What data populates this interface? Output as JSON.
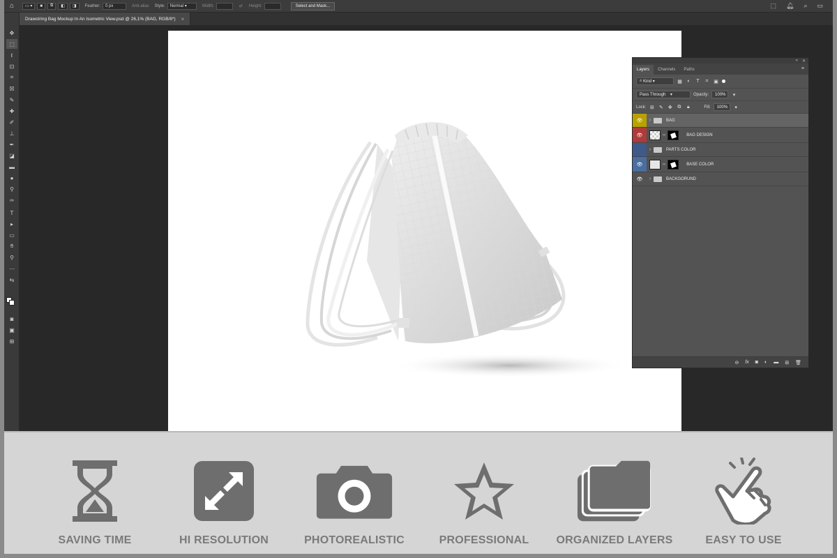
{
  "options_bar": {
    "feather_label": "Feather:",
    "feather_value": "0 px",
    "anti_alias_label": "Anti-alias",
    "style_label": "Style:",
    "style_value": "Normal",
    "width_label": "Width:",
    "height_label": "Height:",
    "select_mask_label": "Select and Mask..."
  },
  "document": {
    "tab_title": "Drawstring Bag Mockup In An Isometric View.psd @ 26,1% (BAG, RGB/8*)",
    "close_glyph": "×"
  },
  "layers_panel": {
    "tabs": [
      "Layers",
      "Channels",
      "Paths"
    ],
    "filter_label": "Kind",
    "blend_mode": "Pass Through",
    "opacity_label": "Opacity:",
    "opacity_value": "100%",
    "lock_label": "Lock:",
    "fill_label": "Fill:",
    "fill_value": "100%",
    "layers": [
      {
        "name": "BAG",
        "type": "group",
        "tag_color": "#b8a200",
        "selected": true
      },
      {
        "name": "BAG DESIGN",
        "type": "smart",
        "tag_color": "#b03a3a",
        "selected": false
      },
      {
        "name": "PARTS COLOR",
        "type": "group",
        "tag_color": "#3e5a8a",
        "selected": false
      },
      {
        "name": "BASE COLOR",
        "type": "fill",
        "tag_color": "#4a6ea0",
        "selected": false
      },
      {
        "name": "BACKGORUND",
        "type": "group",
        "tag_color": "",
        "selected": false
      }
    ]
  },
  "features": [
    {
      "label": "SAVING TIME",
      "icon": "hourglass-icon"
    },
    {
      "label": "HI RESOLUTION",
      "icon": "expand-arrows-icon"
    },
    {
      "label": "PHOTOREALISTIC",
      "icon": "camera-icon"
    },
    {
      "label": "PROFESSIONAL",
      "icon": "star-icon"
    },
    {
      "label": "ORGANIZED LAYERS",
      "icon": "layers-icon"
    },
    {
      "label": "EASY TO USE",
      "icon": "hand-tap-icon"
    }
  ],
  "colors": {
    "feature_icon": "#6e6e6e",
    "feature_label": "#7a7a7a",
    "strip_bg": "#d5d5d5"
  }
}
